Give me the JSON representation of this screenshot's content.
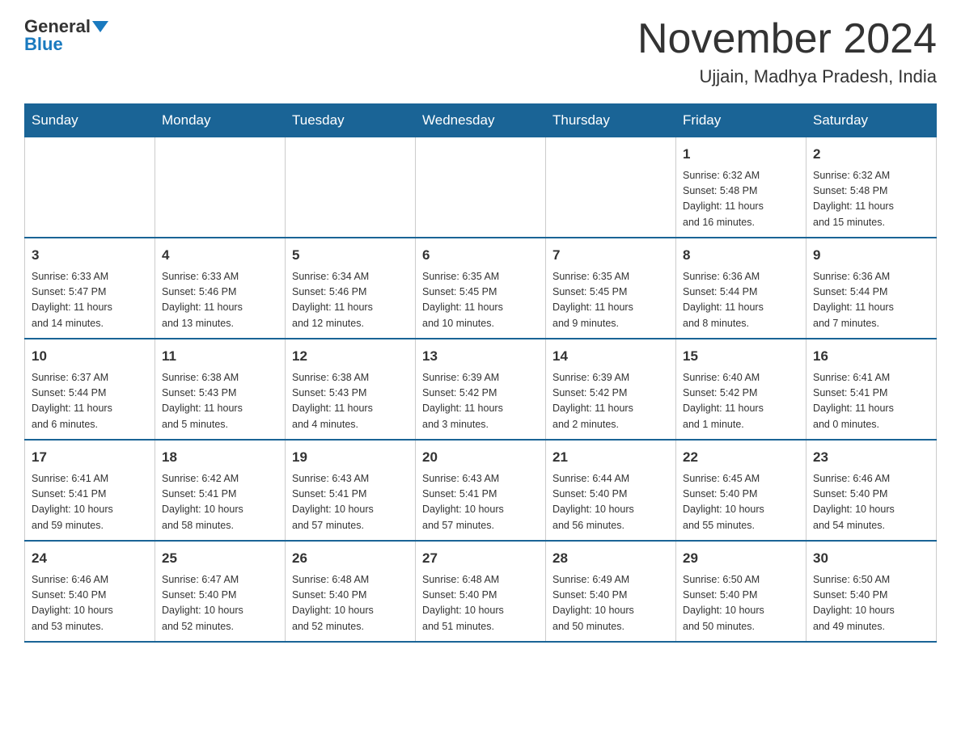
{
  "header": {
    "logo_general": "General",
    "logo_blue": "Blue",
    "month_title": "November 2024",
    "location": "Ujjain, Madhya Pradesh, India"
  },
  "weekdays": [
    "Sunday",
    "Monday",
    "Tuesday",
    "Wednesday",
    "Thursday",
    "Friday",
    "Saturday"
  ],
  "weeks": [
    [
      {
        "day": "",
        "info": ""
      },
      {
        "day": "",
        "info": ""
      },
      {
        "day": "",
        "info": ""
      },
      {
        "day": "",
        "info": ""
      },
      {
        "day": "",
        "info": ""
      },
      {
        "day": "1",
        "info": "Sunrise: 6:32 AM\nSunset: 5:48 PM\nDaylight: 11 hours\nand 16 minutes."
      },
      {
        "day": "2",
        "info": "Sunrise: 6:32 AM\nSunset: 5:48 PM\nDaylight: 11 hours\nand 15 minutes."
      }
    ],
    [
      {
        "day": "3",
        "info": "Sunrise: 6:33 AM\nSunset: 5:47 PM\nDaylight: 11 hours\nand 14 minutes."
      },
      {
        "day": "4",
        "info": "Sunrise: 6:33 AM\nSunset: 5:46 PM\nDaylight: 11 hours\nand 13 minutes."
      },
      {
        "day": "5",
        "info": "Sunrise: 6:34 AM\nSunset: 5:46 PM\nDaylight: 11 hours\nand 12 minutes."
      },
      {
        "day": "6",
        "info": "Sunrise: 6:35 AM\nSunset: 5:45 PM\nDaylight: 11 hours\nand 10 minutes."
      },
      {
        "day": "7",
        "info": "Sunrise: 6:35 AM\nSunset: 5:45 PM\nDaylight: 11 hours\nand 9 minutes."
      },
      {
        "day": "8",
        "info": "Sunrise: 6:36 AM\nSunset: 5:44 PM\nDaylight: 11 hours\nand 8 minutes."
      },
      {
        "day": "9",
        "info": "Sunrise: 6:36 AM\nSunset: 5:44 PM\nDaylight: 11 hours\nand 7 minutes."
      }
    ],
    [
      {
        "day": "10",
        "info": "Sunrise: 6:37 AM\nSunset: 5:44 PM\nDaylight: 11 hours\nand 6 minutes."
      },
      {
        "day": "11",
        "info": "Sunrise: 6:38 AM\nSunset: 5:43 PM\nDaylight: 11 hours\nand 5 minutes."
      },
      {
        "day": "12",
        "info": "Sunrise: 6:38 AM\nSunset: 5:43 PM\nDaylight: 11 hours\nand 4 minutes."
      },
      {
        "day": "13",
        "info": "Sunrise: 6:39 AM\nSunset: 5:42 PM\nDaylight: 11 hours\nand 3 minutes."
      },
      {
        "day": "14",
        "info": "Sunrise: 6:39 AM\nSunset: 5:42 PM\nDaylight: 11 hours\nand 2 minutes."
      },
      {
        "day": "15",
        "info": "Sunrise: 6:40 AM\nSunset: 5:42 PM\nDaylight: 11 hours\nand 1 minute."
      },
      {
        "day": "16",
        "info": "Sunrise: 6:41 AM\nSunset: 5:41 PM\nDaylight: 11 hours\nand 0 minutes."
      }
    ],
    [
      {
        "day": "17",
        "info": "Sunrise: 6:41 AM\nSunset: 5:41 PM\nDaylight: 10 hours\nand 59 minutes."
      },
      {
        "day": "18",
        "info": "Sunrise: 6:42 AM\nSunset: 5:41 PM\nDaylight: 10 hours\nand 58 minutes."
      },
      {
        "day": "19",
        "info": "Sunrise: 6:43 AM\nSunset: 5:41 PM\nDaylight: 10 hours\nand 57 minutes."
      },
      {
        "day": "20",
        "info": "Sunrise: 6:43 AM\nSunset: 5:41 PM\nDaylight: 10 hours\nand 57 minutes."
      },
      {
        "day": "21",
        "info": "Sunrise: 6:44 AM\nSunset: 5:40 PM\nDaylight: 10 hours\nand 56 minutes."
      },
      {
        "day": "22",
        "info": "Sunrise: 6:45 AM\nSunset: 5:40 PM\nDaylight: 10 hours\nand 55 minutes."
      },
      {
        "day": "23",
        "info": "Sunrise: 6:46 AM\nSunset: 5:40 PM\nDaylight: 10 hours\nand 54 minutes."
      }
    ],
    [
      {
        "day": "24",
        "info": "Sunrise: 6:46 AM\nSunset: 5:40 PM\nDaylight: 10 hours\nand 53 minutes."
      },
      {
        "day": "25",
        "info": "Sunrise: 6:47 AM\nSunset: 5:40 PM\nDaylight: 10 hours\nand 52 minutes."
      },
      {
        "day": "26",
        "info": "Sunrise: 6:48 AM\nSunset: 5:40 PM\nDaylight: 10 hours\nand 52 minutes."
      },
      {
        "day": "27",
        "info": "Sunrise: 6:48 AM\nSunset: 5:40 PM\nDaylight: 10 hours\nand 51 minutes."
      },
      {
        "day": "28",
        "info": "Sunrise: 6:49 AM\nSunset: 5:40 PM\nDaylight: 10 hours\nand 50 minutes."
      },
      {
        "day": "29",
        "info": "Sunrise: 6:50 AM\nSunset: 5:40 PM\nDaylight: 10 hours\nand 50 minutes."
      },
      {
        "day": "30",
        "info": "Sunrise: 6:50 AM\nSunset: 5:40 PM\nDaylight: 10 hours\nand 49 minutes."
      }
    ]
  ]
}
